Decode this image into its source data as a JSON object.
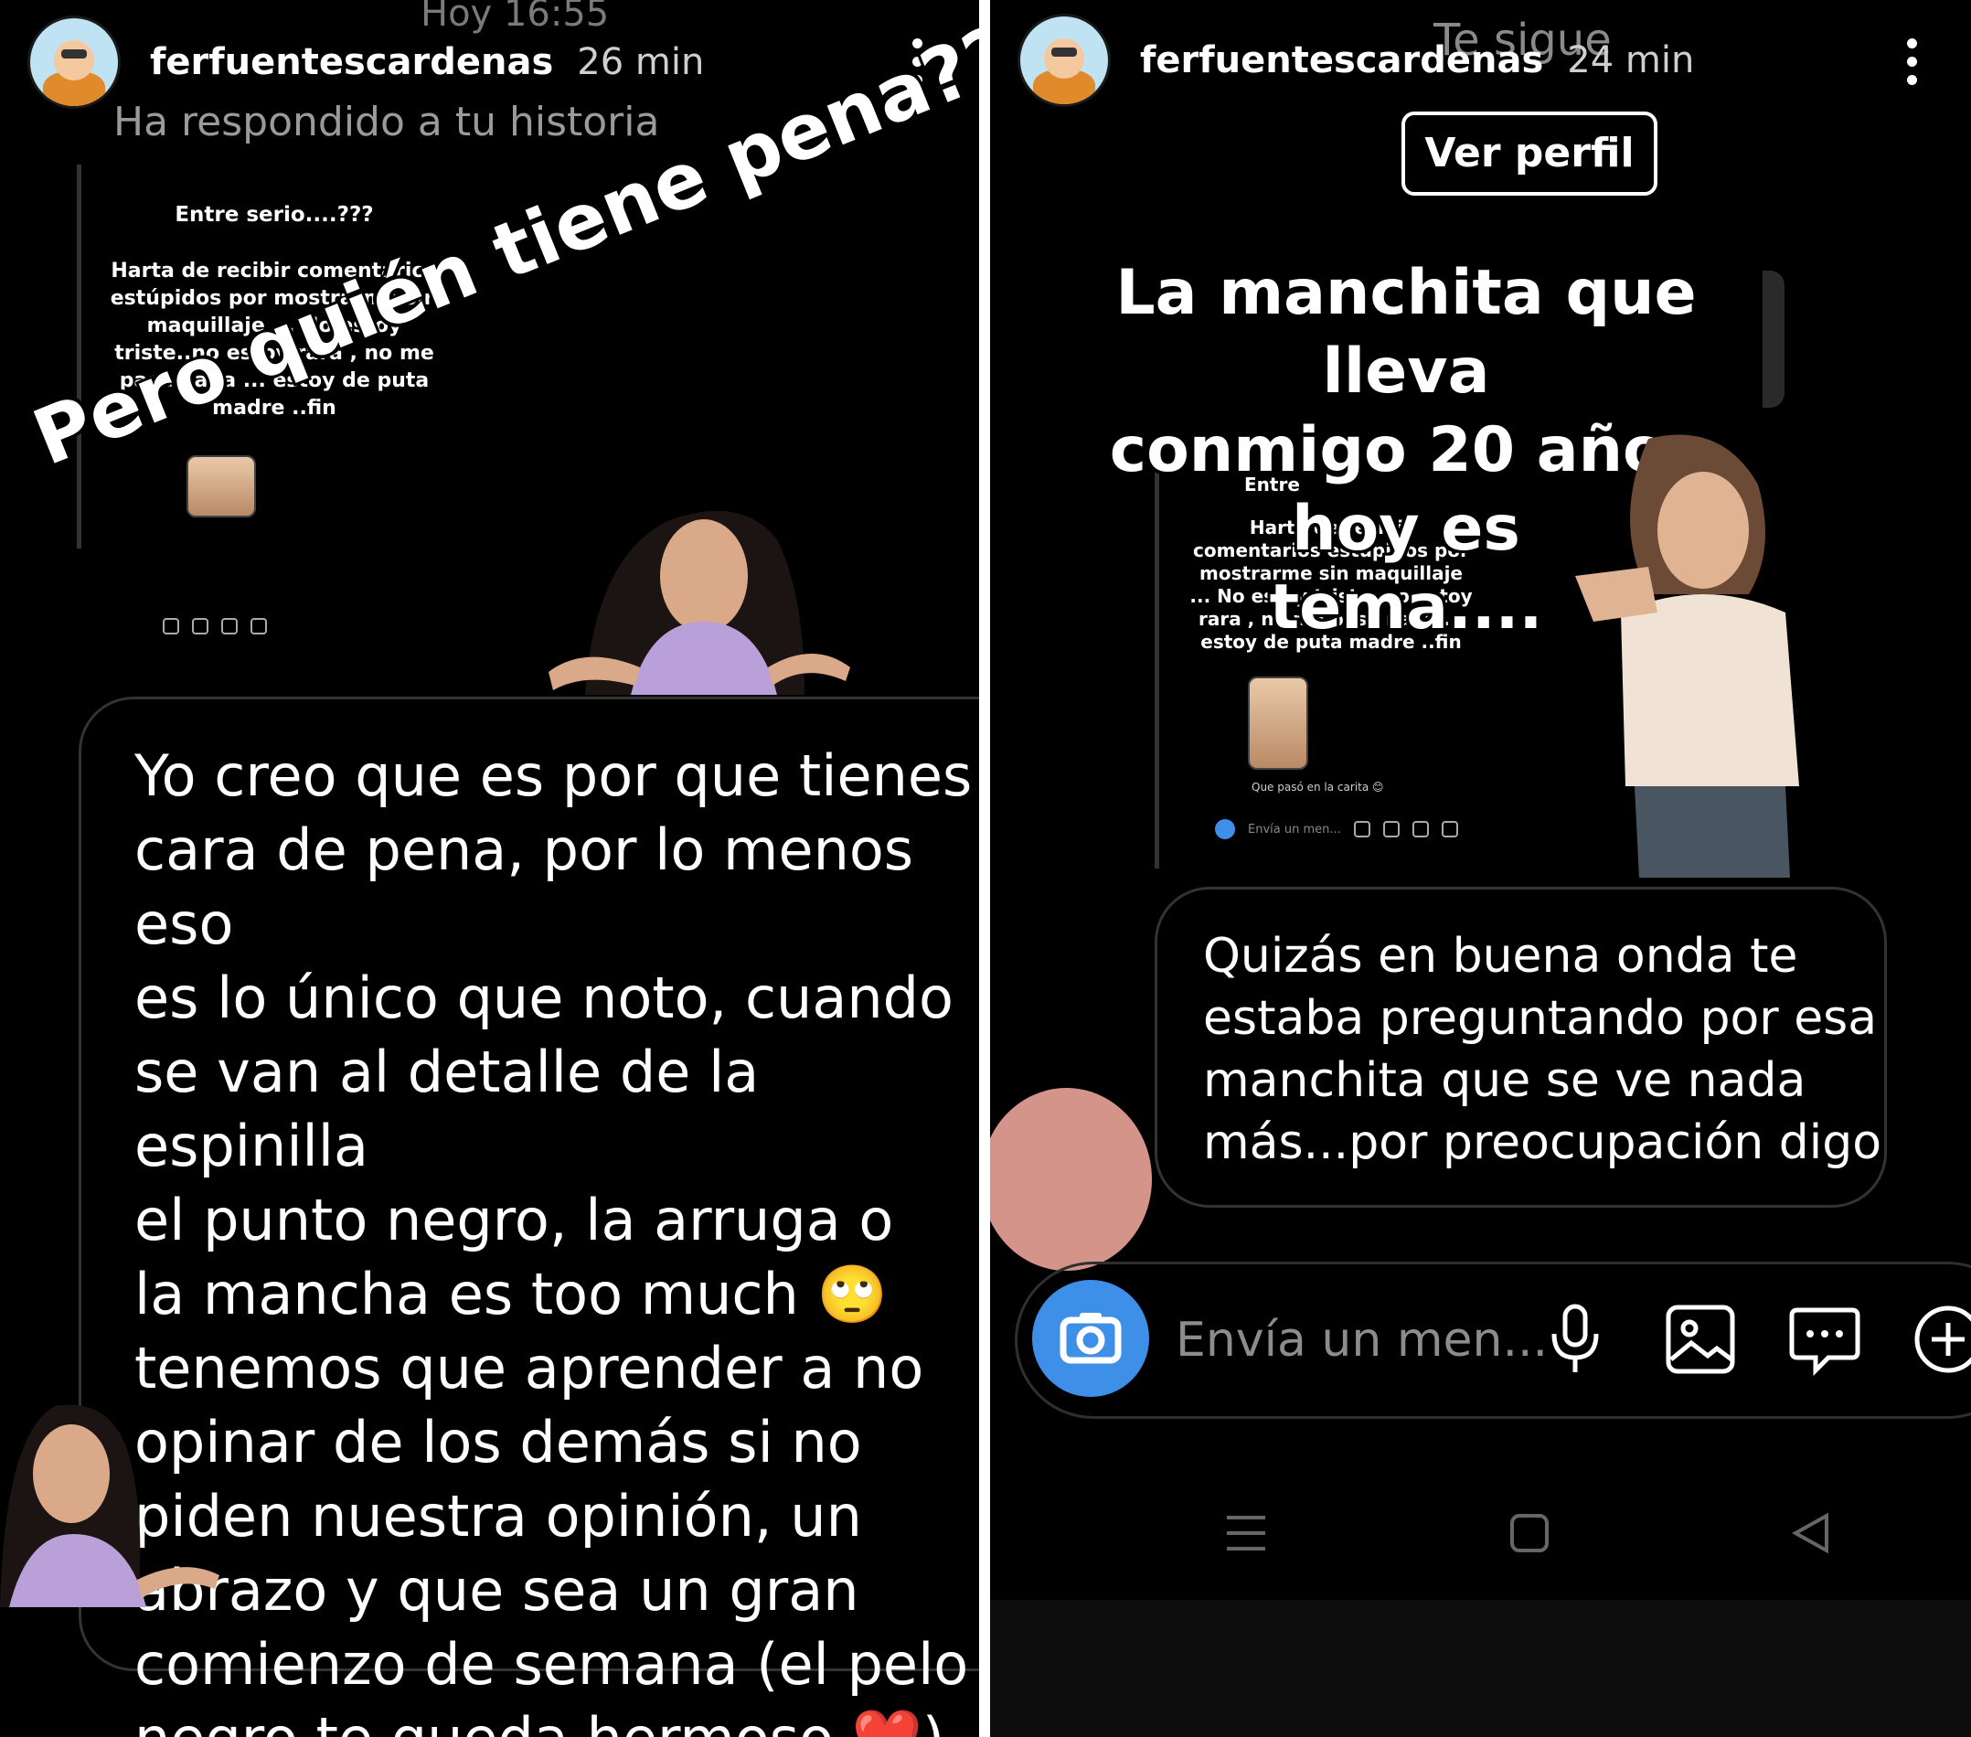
{
  "left": {
    "header": {
      "username": "ferfuentescardenas",
      "time": "26 min",
      "top_ghost": "Hoy 16:55"
    },
    "replied_text": "Ha respondido a tu historia",
    "thumbnail": {
      "title": "Entre serio....???",
      "body": "Harta de recibir comentarios estúpidos por mostrarme sin maquillaje ... No estoy triste..no estoy rara , no me pasa nada ... estoy de puta madre ..fin"
    },
    "sticker_text": "Pero quién tiene pena???",
    "message": "Yo creo que es por que tienes\ncara de pena, por lo menos eso\nes lo único que noto, cuando\nse van al detalle de la espinilla\nel punto negro, la arruga o\nla mancha es too much 🙄\ntenemos que aprender a no\nopinar de los demás si no\npiden nuestra opinión, un\nabrazo y que sea un gran\ncomienzo de semana (el pelo\nnegro te queda hermoso ❤️)"
  },
  "right": {
    "header": {
      "username": "ferfuentescardenas",
      "time": "24 min",
      "ghost": "Te sigue"
    },
    "view_profile_label": "Ver perfil",
    "headline": "La manchita que lleva\nconmigo 20 años hoy es\ntema....",
    "thumbnail": {
      "title": "Entre",
      "body": "Harta de recibir comentarios estúpidos por mostrarme sin maquillaje ... No estoy triste..no estoy rara , no me pasa nada ... estoy de puta madre ..fin",
      "mini_reply": "Que pasó en la carita 😊",
      "mini_input": "Envía un men..."
    },
    "message": "Quizás en buena onda te\nestaba preguntando por esa\nmanchita que se ve nada\nmás...por preocupación digo",
    "input_placeholder": "Envía un men...",
    "icons": [
      "camera-icon",
      "microphone-icon",
      "image-icon",
      "sticker-icon",
      "add-icon"
    ],
    "nav": [
      "menu-icon",
      "home-square-icon",
      "back-triangle-icon"
    ]
  },
  "colors": {
    "camera": "#3d8fe8",
    "bubble_border": "#333333",
    "blob": "#d4948a"
  }
}
